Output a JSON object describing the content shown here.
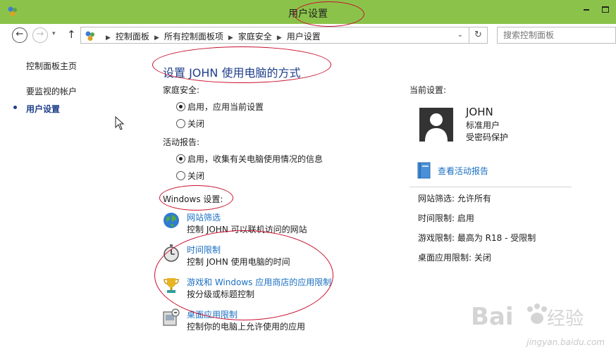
{
  "window": {
    "title": "用户设置"
  },
  "navigation": {
    "back_glyph": "←",
    "forward_glyph": "→",
    "dropdown_glyph": "▾",
    "up_glyph": "↑",
    "breadcrumbs": [
      "控制面板",
      "所有控制面板项",
      "家庭安全",
      "用户设置"
    ],
    "breadcrumb_separator": "▶",
    "address_dropdown_glyph": "⌄",
    "refresh_glyph": "↻",
    "search_placeholder": "搜索控制面板"
  },
  "sidebar": {
    "items": [
      {
        "label": "控制面板主页"
      },
      {
        "label": "要监视的帐户"
      },
      {
        "label": "用户设置",
        "selected": true
      }
    ]
  },
  "main": {
    "title": "设置 JOHN 使用电脑的方式",
    "family_safety": {
      "label": "家庭安全:",
      "options": [
        {
          "label": "启用，应用当前设置",
          "selected": true
        },
        {
          "label": "关闭",
          "selected": false
        }
      ]
    },
    "activity_report": {
      "label": "活动报告:",
      "options": [
        {
          "label": "启用，收集有关电脑使用情况的信息",
          "selected": true
        },
        {
          "label": "关闭",
          "selected": false
        }
      ]
    },
    "windows_settings": {
      "label": "Windows 设置:",
      "items": [
        {
          "icon": "globe-icon",
          "link": "网站筛选",
          "desc": "控制 JOHN 可以联机访问的网站"
        },
        {
          "icon": "stopwatch-icon",
          "link": "时间限制",
          "desc": "控制 JOHN 使用电脑的时间"
        },
        {
          "icon": "trophy-icon",
          "link": "游戏和 Windows 应用商店的应用限制",
          "desc": "按分级或标题控制"
        },
        {
          "icon": "desktop-app-icon",
          "link": "桌面应用限制",
          "desc": "控制你的电脑上允许使用的应用"
        }
      ]
    }
  },
  "current_settings": {
    "label": "当前设置:",
    "user": {
      "name": "JOHN",
      "type": "标准用户",
      "password": "受密码保护"
    },
    "report_link": "查看活动报告",
    "summary": [
      "网站筛选: 允许所有",
      "时间限制: 启用",
      "游戏限制: 最高为 R18 - 受限制",
      "桌面应用限制: 关闭"
    ]
  },
  "watermark": {
    "url": "jingyan.baidu.com"
  },
  "colors": {
    "titlebar": "#8bc34a",
    "link": "#1a6fc2",
    "heading": "#1e3f8a",
    "annotation": "#c8102e"
  }
}
